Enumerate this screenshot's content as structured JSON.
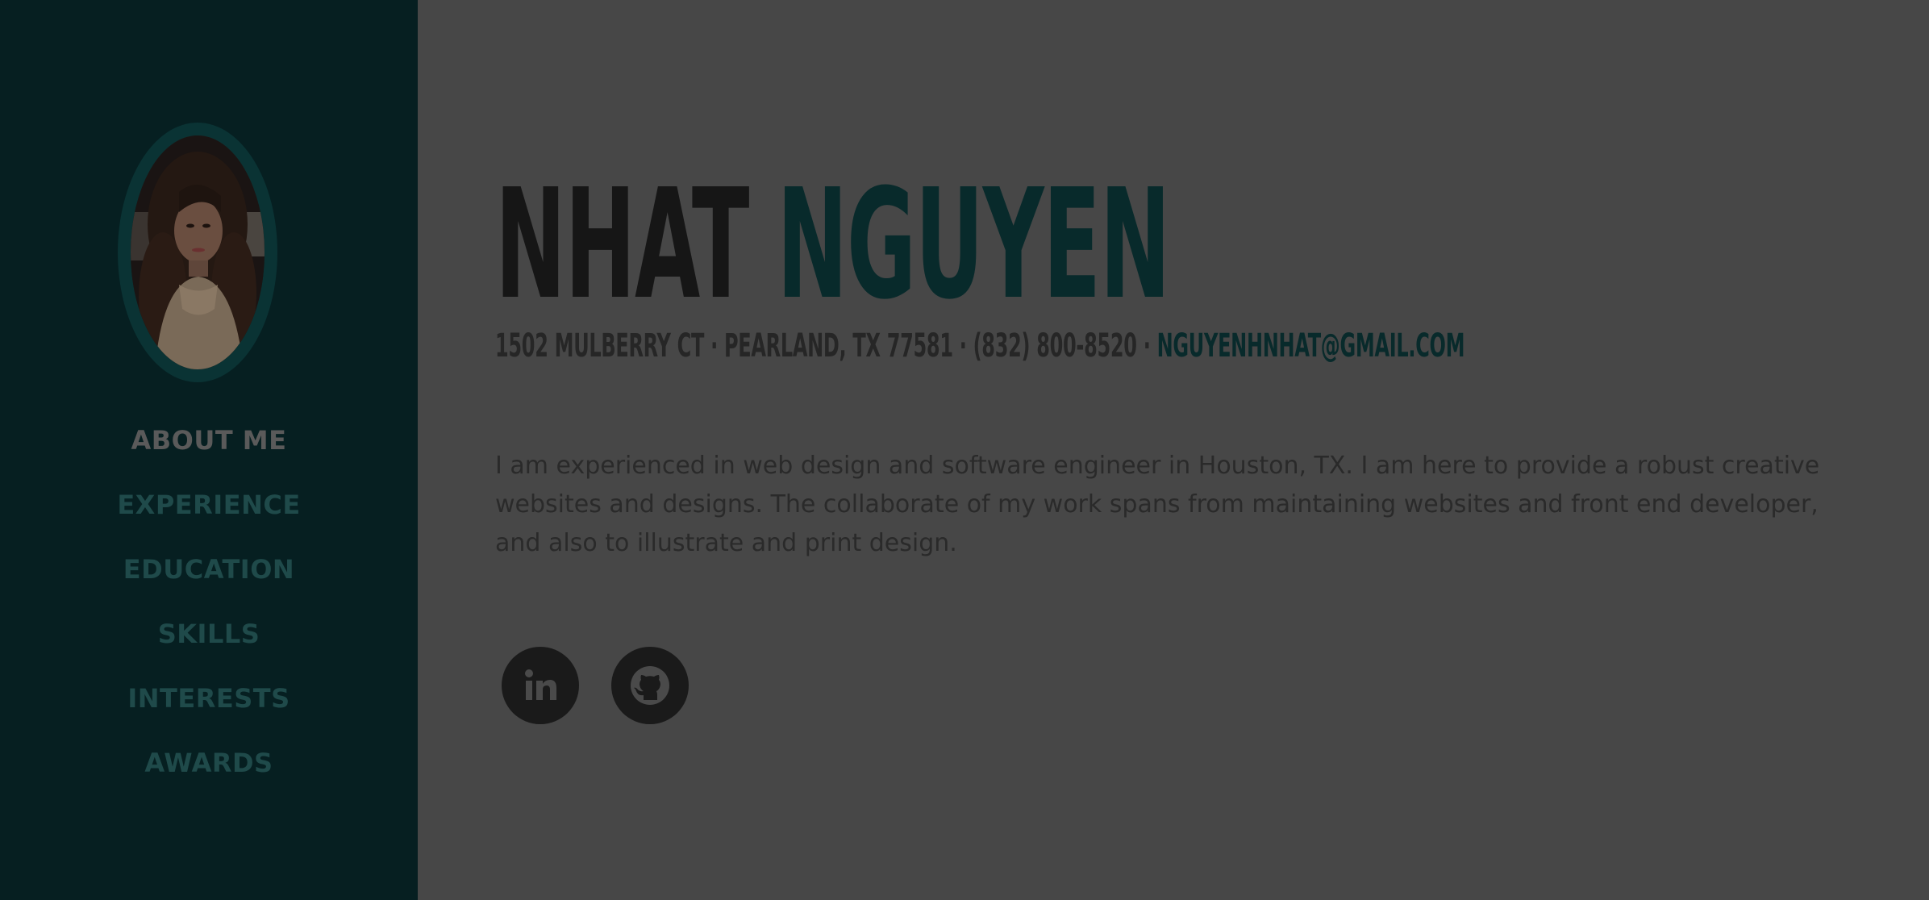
{
  "sidebar": {
    "nav": [
      {
        "label": "ABOUT ME"
      },
      {
        "label": "EXPERIENCE"
      },
      {
        "label": "EDUCATION"
      },
      {
        "label": "SKILLS"
      },
      {
        "label": "INTERESTS"
      },
      {
        "label": "AWARDS"
      }
    ],
    "active_index": 0
  },
  "header": {
    "first_name": "NHAT",
    "last_name": "NGUYEN"
  },
  "contact": {
    "address": "1502 MULBERRY CT · PEARLAND, TX 77581 · (832) 800-8520 · ",
    "email": "NGUYENHNHAT@GMAIL.COM"
  },
  "about": {
    "text": "I am experienced in web design and software engineer in Houston, TX. I am here to provide a robust creative websites and designs. The collaborate of my work spans from maintaining websites and front end developer, and also to illustrate and print design."
  },
  "social": {
    "items": [
      {
        "icon": "linkedin-icon"
      },
      {
        "icon": "github-icon"
      }
    ]
  },
  "colors": {
    "sidebar_bg": "#061f21",
    "main_bg": "#474747",
    "accent": "#082a2b",
    "nav_active": "#5a5a5a",
    "nav_inactive": "#1f4a4a"
  }
}
